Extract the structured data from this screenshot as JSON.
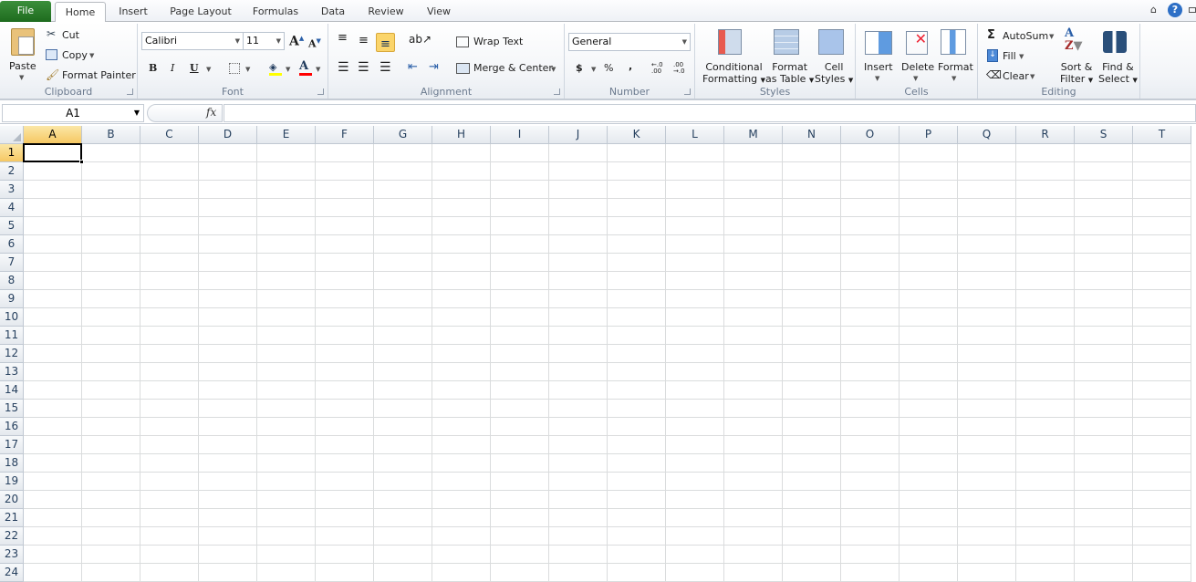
{
  "tabs": {
    "file": "File",
    "items": [
      "Home",
      "Insert",
      "Page Layout",
      "Formulas",
      "Data",
      "Review",
      "View"
    ]
  },
  "clipboard": {
    "label": "Clipboard",
    "paste": "Paste",
    "cut": "Cut",
    "copy": "Copy",
    "format_painter": "Format Painter"
  },
  "font": {
    "label": "Font",
    "name": "Calibri",
    "size": "11",
    "bold": "B",
    "italic": "I",
    "underline": "U",
    "fill_color": "#ffff00",
    "font_color": "#ff0000"
  },
  "alignment": {
    "label": "Alignment",
    "wrap_text": "Wrap Text",
    "merge_center": "Merge & Center"
  },
  "number": {
    "label": "Number",
    "format": "General",
    "currency": "$",
    "percent": "%",
    "comma": ",",
    "inc_decimal": "←.0 .00",
    "dec_decimal": ".00 →.0"
  },
  "styles": {
    "label": "Styles",
    "conditional": [
      "Conditional",
      "Formatting"
    ],
    "format_table": [
      "Format",
      "as Table"
    ],
    "cell_styles": [
      "Cell",
      "Styles"
    ]
  },
  "cells": {
    "label": "Cells",
    "insert": "Insert",
    "delete": "Delete",
    "format": "Format"
  },
  "editing": {
    "label": "Editing",
    "autosum": "AutoSum",
    "fill": "Fill",
    "clear": "Clear",
    "sort_filter": [
      "Sort &",
      "Filter"
    ],
    "find_select": [
      "Find &",
      "Select"
    ]
  },
  "formula_bar": {
    "name_box": "A1",
    "fx": "fx",
    "value": ""
  },
  "sheet": {
    "columns": [
      "A",
      "B",
      "C",
      "D",
      "E",
      "F",
      "G",
      "H",
      "I",
      "J",
      "K",
      "L",
      "M",
      "N",
      "O",
      "P",
      "Q",
      "R",
      "S",
      "T"
    ],
    "rows": [
      "1",
      "2",
      "3",
      "4",
      "5",
      "6",
      "7",
      "8",
      "9",
      "10",
      "11",
      "12",
      "13",
      "14",
      "15",
      "16",
      "17",
      "18",
      "19",
      "20",
      "21",
      "22",
      "23",
      "24"
    ],
    "active_cell": "A1"
  }
}
